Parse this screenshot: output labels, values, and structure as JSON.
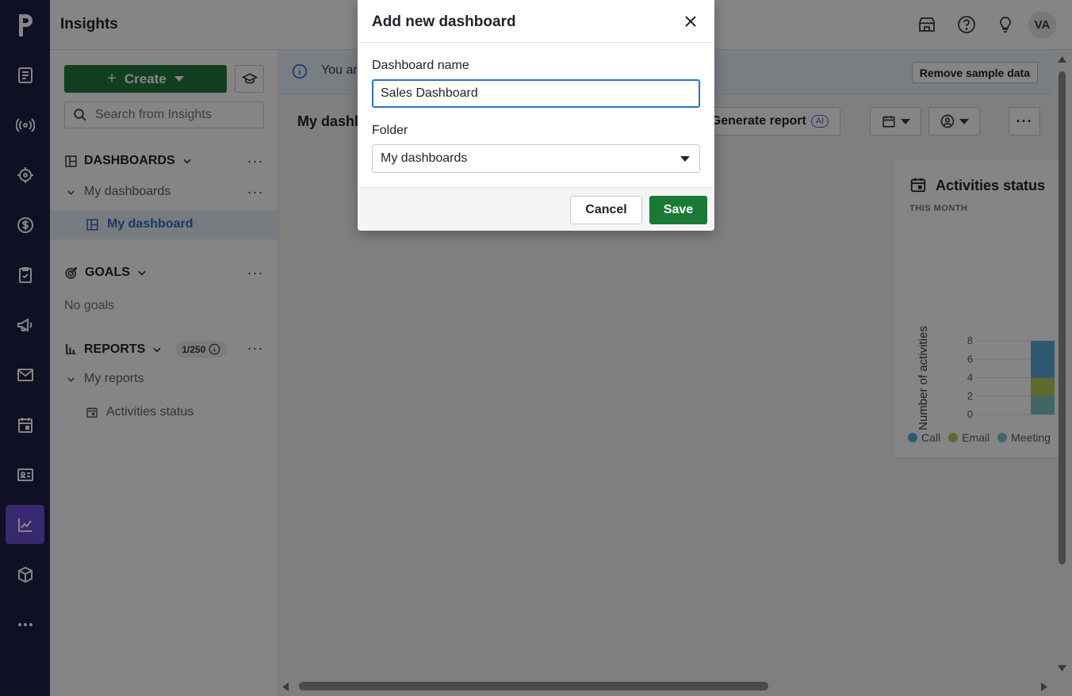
{
  "header": {
    "title": "Insights",
    "icons": [
      "marketplace-icon",
      "help-icon",
      "lightbulb-icon"
    ],
    "avatar_initials": "VA"
  },
  "rail": {
    "items": [
      "deals-icon",
      "leads-icon",
      "campaigns-target-icon",
      "revenue-icon",
      "projects-icon",
      "campaigns-megaphone-icon",
      "mail-icon",
      "activities-icon",
      "contacts-icon",
      "insights-icon",
      "products-icon",
      "more-icon"
    ],
    "active": "insights-icon"
  },
  "sidebar": {
    "create_label": "Create",
    "search_placeholder": "Search from Insights",
    "dashboards_label": "DASHBOARDS",
    "my_dashboards_label": "My dashboards",
    "my_dashboard_label": "My dashboard",
    "goals_label": "GOALS",
    "no_goals_label": "No goals",
    "reports_label": "REPORTS",
    "reports_count": "1/250",
    "my_reports_label": "My reports",
    "report_item_label": "Activities status"
  },
  "main": {
    "info_text": "You ar",
    "remove_sample_label": "Remove sample data",
    "dashboard_title": "My dashl",
    "generate_report_label": "Generate report",
    "ai_badge": "AI",
    "widget": {
      "title": "Activities status",
      "subtitle": "THIS MONTH"
    }
  },
  "chart_data": {
    "type": "bar",
    "ylabel": "Number of activities",
    "yticks": [
      "8",
      "6",
      "4",
      "2",
      "0"
    ],
    "ylim": [
      0,
      8
    ],
    "series": [
      {
        "name": "Call",
        "values": [
          4
        ],
        "color": "#5ba9dd"
      },
      {
        "name": "Email",
        "values": [
          2
        ],
        "color": "#b8c95a"
      },
      {
        "name": "Meeting",
        "values": [
          2
        ],
        "color": "#7cc4c6"
      }
    ]
  },
  "modal": {
    "title": "Add new dashboard",
    "name_label": "Dashboard name",
    "name_value": "Sales Dashboard",
    "folder_label": "Folder",
    "folder_value": "My dashboards",
    "cancel_label": "Cancel",
    "save_label": "Save"
  }
}
